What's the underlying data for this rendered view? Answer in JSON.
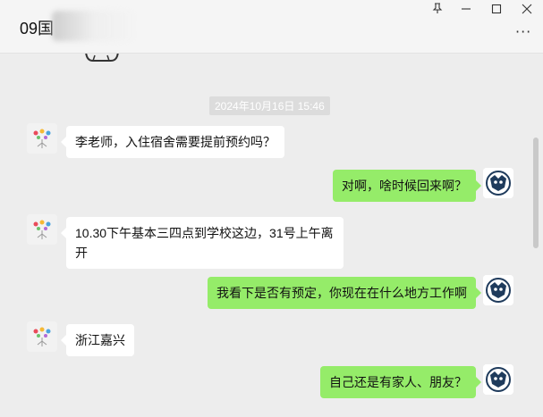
{
  "window": {
    "title": "09国",
    "pin_icon": "pin-icon",
    "minimize_icon": "minimize-icon",
    "maximize_icon": "maximize-icon",
    "close_icon": "close-icon",
    "more_icon": "more-icon"
  },
  "chat": {
    "timestamp": "2024年10月16日 15:46",
    "messages": [
      {
        "side": "left",
        "text": "李老师，入住宿舍需要提前预约吗？"
      },
      {
        "side": "right",
        "text": "对啊，啥时候回来啊？"
      },
      {
        "side": "left",
        "text": "10.30下午基本三四点到学校这边，31号上午离开"
      },
      {
        "side": "right",
        "text": "我看下是否有预定，你现在在什么地方工作啊"
      },
      {
        "side": "left",
        "text": "浙江嘉兴"
      },
      {
        "side": "right",
        "text": "自己还是有家人、朋友？"
      }
    ]
  },
  "colors": {
    "background": "#ededed",
    "bubble_self": "#95ec69",
    "bubble_other": "#ffffff"
  }
}
